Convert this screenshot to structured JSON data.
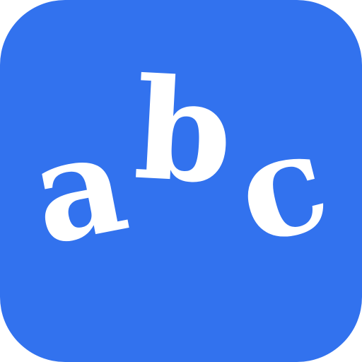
{
  "app_icon": {
    "background_color": "#3272EE",
    "glyph_color": "#FFFFFF",
    "letters": [
      "a",
      "b",
      "c"
    ]
  }
}
